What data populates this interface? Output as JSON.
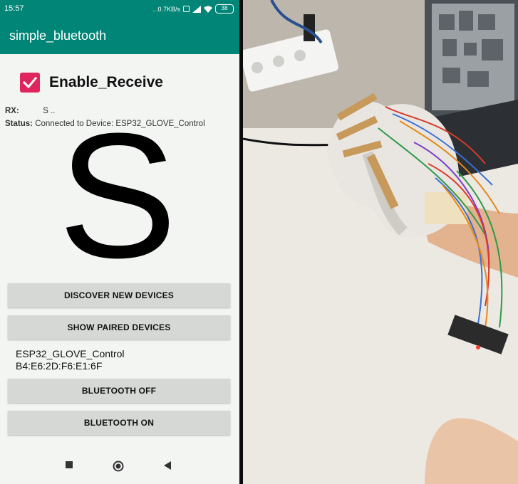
{
  "status_bar": {
    "time": "15:57",
    "indicators": "...0.7KB/s",
    "battery": "38"
  },
  "app_bar": {
    "title": "simple_bluetooth"
  },
  "enable_receive": {
    "label": "Enable_Receive",
    "checked": true
  },
  "rx": {
    "label": "RX:",
    "value": "S .."
  },
  "status": {
    "label": "Status:",
    "value": "Connected to Device: ESP32_GLOVE_Control"
  },
  "received_char": "S",
  "buttons": {
    "discover": "DISCOVER NEW DEVICES",
    "paired": "SHOW PAIRED DEVICES",
    "off": "BLUETOOTH OFF",
    "on": "BLUETOOTH ON"
  },
  "paired_devices": [
    {
      "name": "ESP32_GLOVE_Control",
      "address": "B4:E6:2D:F6:E1:6F"
    }
  ],
  "colors": {
    "accent": "#008577",
    "checkbox": "#e0245e",
    "button_bg": "#d6d8d6"
  },
  "icons": {
    "nav_recent": "square-icon",
    "nav_home": "circle-icon",
    "nav_back": "triangle-back-icon"
  }
}
